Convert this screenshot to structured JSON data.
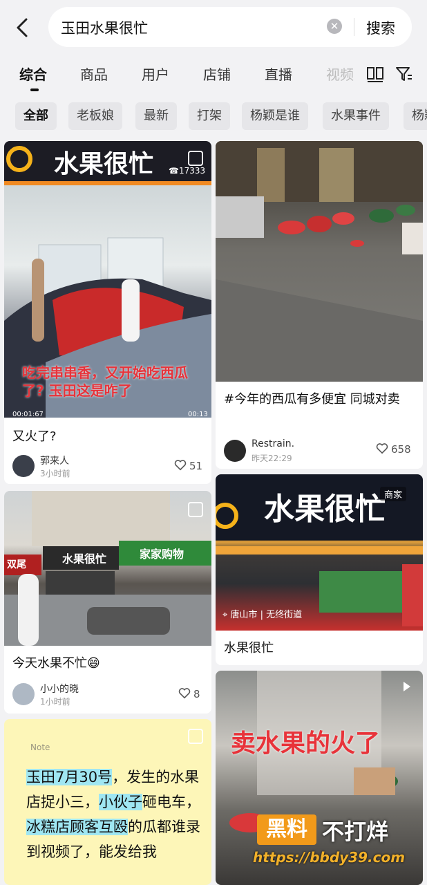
{
  "search": {
    "query": "玉田水果很忙",
    "button_label": "搜索"
  },
  "tabs": [
    {
      "label": "综合",
      "active": true
    },
    {
      "label": "商品"
    },
    {
      "label": "用户"
    },
    {
      "label": "店铺"
    },
    {
      "label": "直播"
    },
    {
      "label": "视频"
    }
  ],
  "chips": [
    "全部",
    "老板娘",
    "最新",
    "打架",
    "杨颖是谁",
    "水果事件",
    "杨颖"
  ],
  "cards": [
    {
      "image_caption": "吃完串串香，又开始吃西瓜了? 玉田这是咋了",
      "video_start": "00:01:67",
      "video_end": "00:13",
      "sign_text": "水果很忙",
      "phone": "☎17333",
      "title": "又火了?",
      "user": "郭来人",
      "time": "3小时前",
      "likes": "51"
    },
    {
      "title": "#今年的西瓜有多便宜 同城对卖",
      "user": "Restrain.",
      "time": "昨天22:29",
      "likes": "658"
    },
    {
      "sign_left": "双尾",
      "sign_mid": "水果很忙",
      "sign_right": "家家购物",
      "title": "今天水果不忙😄",
      "user": "小小的晓",
      "time": "1小时前",
      "likes": "8"
    },
    {
      "sign_text": "水果很忙",
      "badge": "商家",
      "location": "唐山市 | 无终街道",
      "title": "水果很忙"
    },
    {
      "note_label": "Note",
      "note_parts": [
        "玉田7月30号",
        "，发生的水果店捉小三，",
        "小伙子",
        "砸电车，",
        "冰糕店顾客互殴",
        "的瓜都谁录到视频了，能发给我"
      ]
    },
    {
      "image_caption": "卖水果的火了"
    }
  ],
  "watermark": {
    "badge": "黑料",
    "text": "不打烊",
    "url": "https://bbdy39.com"
  },
  "colors": {
    "accent_red": "#e8333a",
    "watermark_orange": "#f29a1a",
    "highlight": "#9fe6f2"
  }
}
